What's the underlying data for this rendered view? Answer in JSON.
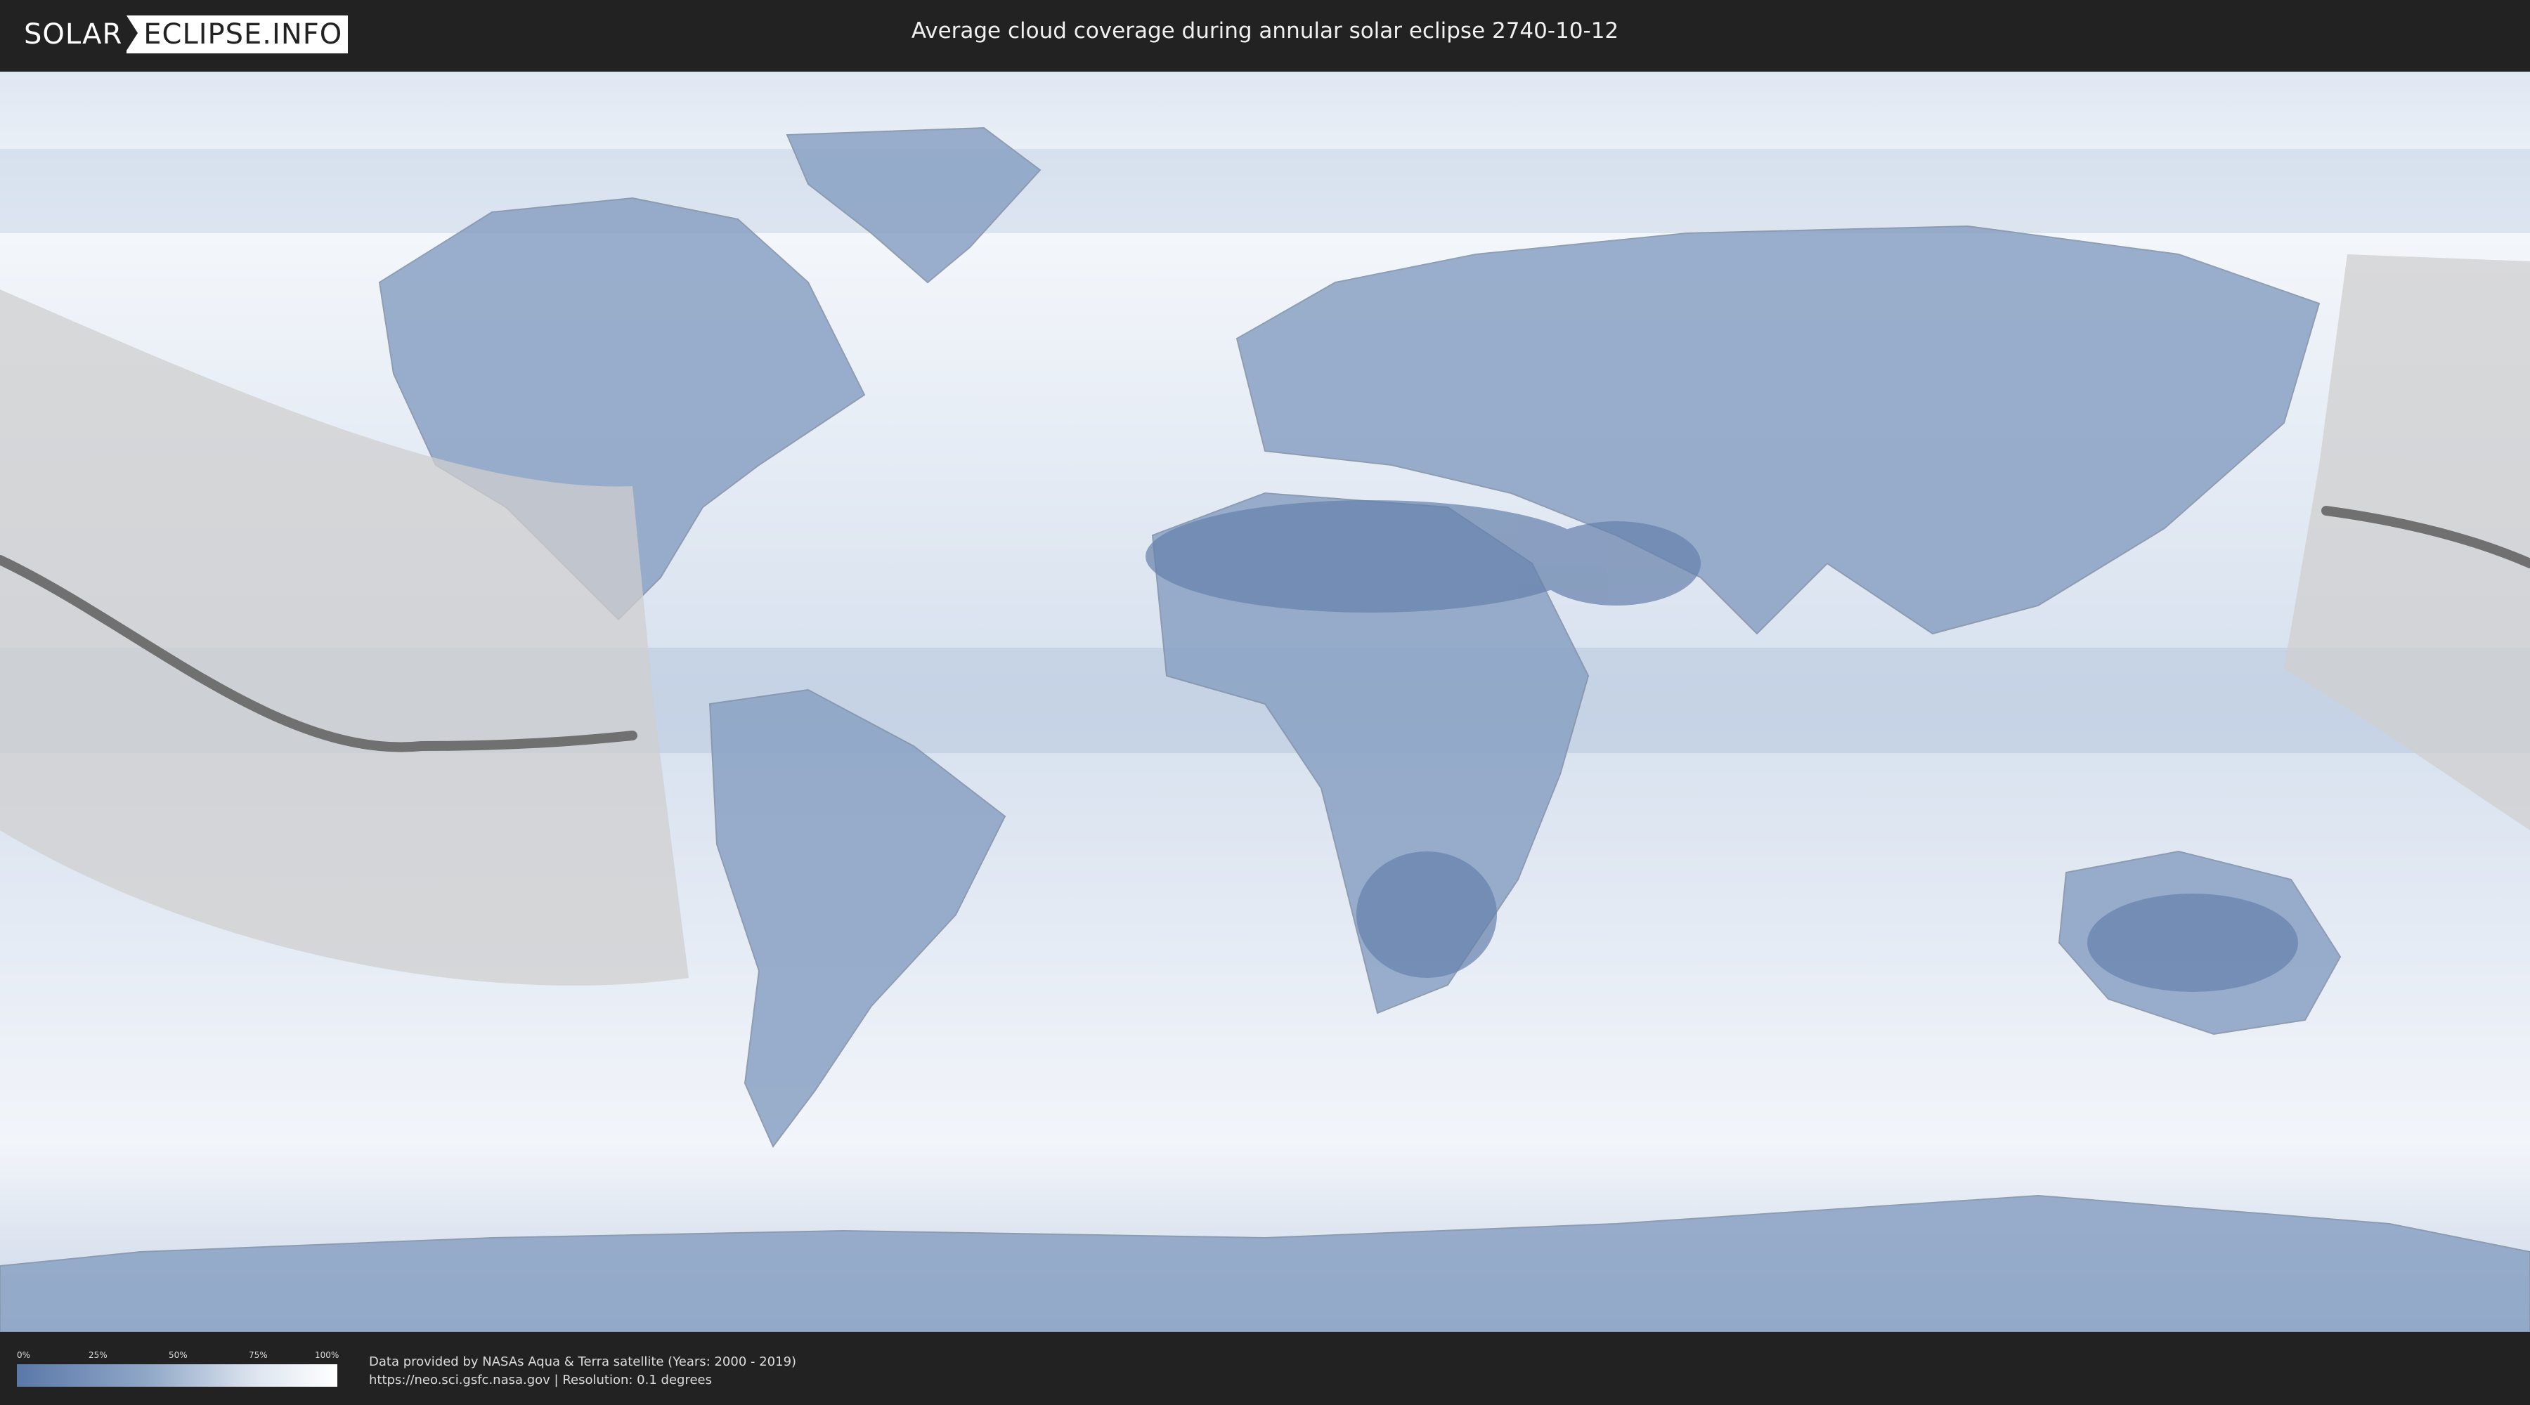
{
  "header": {
    "logo_left": "SOLAR",
    "logo_right": "ECLIPSE.INFO",
    "title": "Average cloud coverage during annular solar eclipse 2740-10-12"
  },
  "legend": {
    "ticks": [
      "0%",
      "25%",
      "50%",
      "75%",
      "100%"
    ],
    "colors": {
      "low": "#5a78a8",
      "high": "#ffffff"
    }
  },
  "credits": {
    "line1": "Data provided by NASAs Aqua & Terra satellite (Years: 2000 - 2019)",
    "line2": "https://neo.sci.gsfc.nasa.gov | Resolution: 0.1 degrees"
  },
  "map": {
    "projection": "equirectangular",
    "ocean_color": "#e8eef6",
    "land_cloud_color": "#6e8bb5",
    "eclipse_zone_color": "#c8c8c8",
    "central_line_color": "#707070"
  }
}
